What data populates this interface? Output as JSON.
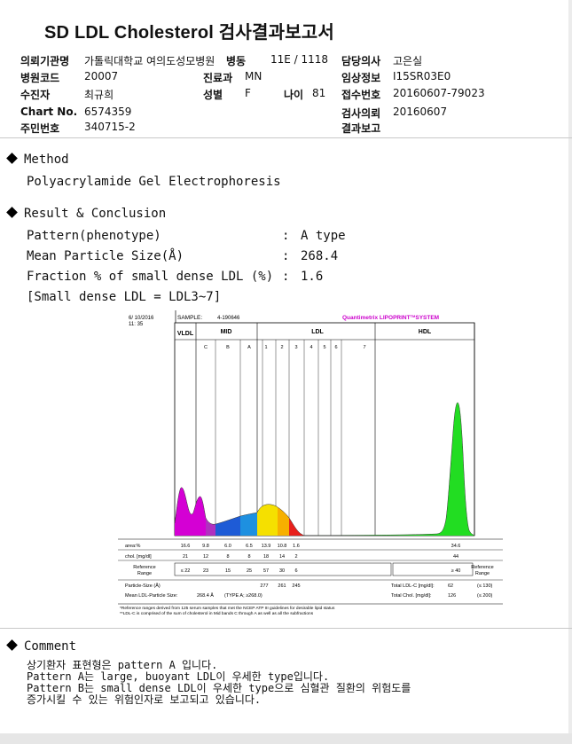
{
  "report": {
    "title": "SD LDL Cholesterol 검사결과보고서",
    "header": {
      "institution_label": "의뢰기관명",
      "institution_value": "가톨릭대학교 여의도성모병원",
      "ward_label": "병동",
      "ward_value": "11E / 1118",
      "doctor_label": "담당의사",
      "doctor_value": "고은실",
      "hospital_code_label": "병원코드",
      "hospital_code_value": "20007",
      "department_label": "진료과",
      "department_value": "MN",
      "clinical_info_label": "임상정보",
      "clinical_info_value": "I15SR03E0",
      "patient_label": "수진자",
      "patient_value": "최규희",
      "sex_label": "성별",
      "sex_value": "F",
      "age_label": "나이",
      "age_value": "81",
      "receipt_label": "접수번호",
      "receipt_value": "20160607-79023",
      "chart_label": "Chart No.",
      "chart_value": "6574359",
      "test_request_label": "검사의뢰",
      "test_request_value": "20160607",
      "id_label": "주민번호",
      "id_value": "340715-2",
      "result_report_label": "결과보고",
      "result_report_value": ""
    },
    "method": {
      "heading": "Method",
      "text": "Polyacrylamide Gel Electrophoresis"
    },
    "result": {
      "heading": "Result & Conclusion",
      "rows": [
        {
          "label": "Pattern(phenotype)",
          "value": "A type"
        },
        {
          "label": "Mean Particle Size(Å)",
          "value": "268.4"
        },
        {
          "label": "Fraction % of small dense LDL (%)",
          "value": "1.6"
        }
      ],
      "separator": ":",
      "note": "[Small dense LDL = LDL3~7]"
    },
    "comment": {
      "heading": "Comment",
      "lines": [
        "상기환자 표현형은 pattern A 입니다.",
        "Pattern A는 large, buoyant LDL이 우세한 type입니다.",
        "Pattern B는 small dense LDL이 우세한 type으로 심혈관 질환의 위험도를",
        "증가시킬 수 있는 위험인자로 보고되고 있습니다."
      ]
    }
  },
  "lipoprint": {
    "date": "6/ 10/2016",
    "time": "11: 35",
    "sample_label": "SAMPLE:",
    "sample_value": "4-190646",
    "brand": "Quantimetrix LIPOPRINT",
    "brand_tm": "TM",
    "brand_system": "SYSTEM",
    "regions": {
      "vldl": "VLDL",
      "mid": "MID",
      "ldl": "LDL",
      "hdl": "HDL"
    },
    "mid_bands": [
      "C",
      "B",
      "A"
    ],
    "ldl_bands": [
      "1",
      "2",
      "3",
      "4",
      "5",
      "6",
      "7"
    ],
    "table": {
      "area_label": "area:%",
      "area_values": [
        "16.6",
        "9.8",
        "6.0",
        "6.5",
        "13.9",
        "10.8",
        "1.6"
      ],
      "hdl_area": "34.6",
      "chol_label": "chol. [mg/dl]",
      "chol_values": [
        "21",
        "12",
        "8",
        "8",
        "18",
        "14",
        "2"
      ],
      "hdl_chol": "44",
      "ref_label_1": "Reference",
      "ref_label_2": "Range",
      "ref_values": [
        "≤ 22",
        "23",
        "15",
        "25",
        "57",
        "30",
        "6"
      ],
      "hdl_ref": "≥ 40",
      "particle_size_label": "Particle-Size (Å)",
      "particle_sizes": [
        "277",
        "261",
        "245"
      ],
      "mean_ldl_label": "Mean LDL-Particle Size:",
      "mean_ldl_value": "268.4 Å",
      "mean_ldl_type": "(TYPE A; ≥268.0)",
      "total_ldl_label": "Total LDL-C [mg/dl]:",
      "total_ldl_value": "62",
      "total_ldl_range": "(≤ 130)",
      "total_chol_label": "Total Chol. [mg/dl]:",
      "total_chol_value": "126",
      "total_chol_range": "(≤ 200)",
      "right_ref_1": "Reference",
      "right_ref_2": "Range"
    },
    "footnote_1": "*Reference ranges derived from 125 serum samples that met the NCEP ATP III guidelines for desirable lipid status",
    "footnote_2": "**LDL-C is comprised of the sum of cholesterol in Mid bands C through A as well as all the subfractions",
    "colors": {
      "vldl": "#d400d4",
      "mid_c": "#c020c0",
      "mid_b": "#1e5bd6",
      "mid_a": "#1e90e0",
      "ldl1": "#f5e000",
      "ldl2": "#f7b000",
      "ldl3": "#e8201c",
      "hdl": "#22dd22",
      "brand": "#cc00cc"
    }
  }
}
